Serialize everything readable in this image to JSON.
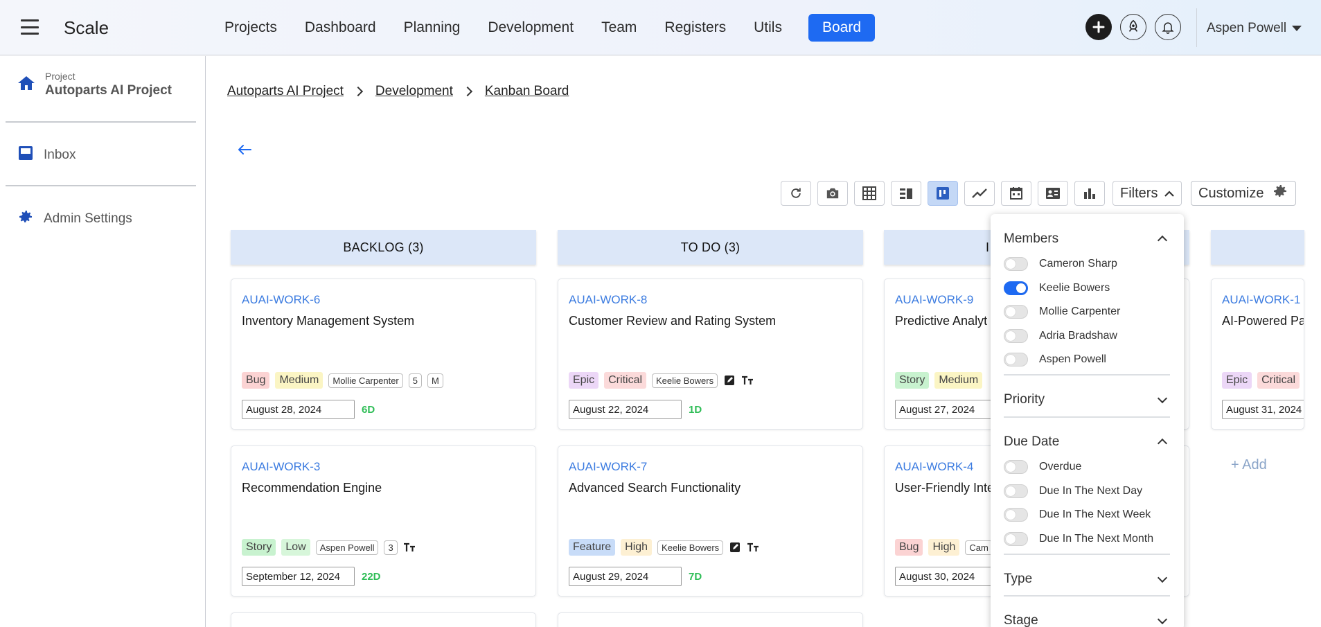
{
  "app": {
    "brand": "Scale",
    "menu_icon": "hamburger-icon"
  },
  "nav": {
    "items": [
      "Projects",
      "Dashboard",
      "Planning",
      "Development",
      "Team",
      "Registers",
      "Utils"
    ],
    "active": "Board"
  },
  "user": {
    "name": "Aspen Powell"
  },
  "sidebar": {
    "project_kicker": "Project",
    "project_name": "Autoparts AI Project",
    "items": [
      {
        "label": "Inbox",
        "icon": "inbox-icon"
      },
      {
        "label": "Admin Settings",
        "icon": "gear-icon"
      }
    ]
  },
  "breadcrumb": [
    "Autoparts AI Project",
    "Development",
    "Kanban Board"
  ],
  "toolbar": {
    "filters_label": "Filters",
    "customize_label": "Customize"
  },
  "columns": [
    {
      "title": "BACKLOG (3)"
    },
    {
      "title": "TO DO (3)"
    },
    {
      "title": "I"
    },
    {
      "title": ""
    }
  ],
  "cards": {
    "c1": {
      "key": "AUAI-WORK-6",
      "title": "Inventory Management System",
      "type": "Bug",
      "priority": "Medium",
      "assignee": "Mollie Carpenter",
      "points": "5",
      "size": "M",
      "date": "August 28, 2024",
      "days": "6D"
    },
    "c2": {
      "key": "AUAI-WORK-3",
      "title": "Recommendation Engine",
      "type": "Story",
      "priority": "Low",
      "assignee": "Aspen Powell",
      "points": "3",
      "date": "September 12, 2024",
      "days": "22D"
    },
    "c3": {
      "key": "AUAI-WORK-8",
      "title": "Customer Review and Rating System",
      "type": "Epic",
      "priority": "Critical",
      "assignee": "Keelie Bowers",
      "date": "August 22, 2024",
      "days": "1D"
    },
    "c4": {
      "key": "AUAI-WORK-7",
      "title": "Advanced Search Functionality",
      "type": "Feature",
      "priority": "High",
      "assignee": "Keelie Bowers",
      "date": "August 29, 2024",
      "days": "7D"
    },
    "c5": {
      "key": "AUAI-WORK-9",
      "title": "Predictive Analyt",
      "type": "Story",
      "priority": "Medium",
      "date": "August 27, 2024"
    },
    "c6": {
      "key": "AUAI-WORK-4",
      "title": "User-Friendly Inte",
      "type": "Bug",
      "priority": "High",
      "assignee": "Cam",
      "date": "August 30, 2024"
    },
    "c7": {
      "key": "AUAI-WORK-1",
      "title": "AI-Powered Pa",
      "type": "Epic",
      "priority": "Critical",
      "date": "August 31, 2024"
    }
  },
  "add_label": "+ Add",
  "filters": {
    "members": {
      "title": "Members",
      "options": [
        {
          "label": "Cameron Sharp",
          "on": false
        },
        {
          "label": "Keelie Bowers",
          "on": true
        },
        {
          "label": "Mollie Carpenter",
          "on": false
        },
        {
          "label": "Adria Bradshaw",
          "on": false
        },
        {
          "label": "Aspen Powell",
          "on": false
        }
      ]
    },
    "priority": {
      "title": "Priority"
    },
    "due_date": {
      "title": "Due Date",
      "options": [
        {
          "label": "Overdue",
          "on": false
        },
        {
          "label": "Due In The Next Day",
          "on": false
        },
        {
          "label": "Due In The Next Week",
          "on": false
        },
        {
          "label": "Due In The Next Month",
          "on": false
        }
      ]
    },
    "type": {
      "title": "Type"
    },
    "stage": {
      "title": "Stage"
    }
  },
  "colors": {
    "accent": "#1e6af2",
    "link": "#3b7be0",
    "column_header": "#dce7f8",
    "days_green": "#2ebd56"
  }
}
